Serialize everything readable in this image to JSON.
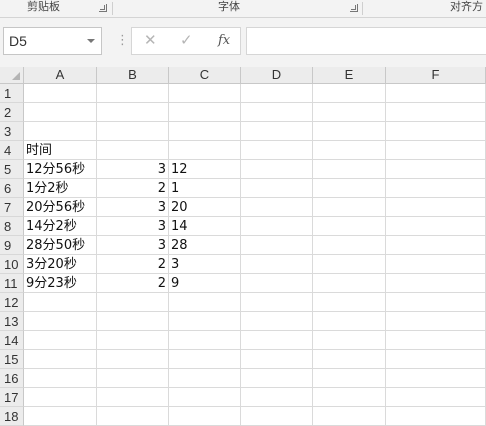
{
  "ribbon": {
    "groups": [
      {
        "label": "剪贴板"
      },
      {
        "label": "字体"
      },
      {
        "label": "对齐方"
      }
    ]
  },
  "formula_bar": {
    "name_box": "D5",
    "cancel_symbol": "✕",
    "enter_symbol": "✓",
    "fx_label": "fx",
    "formula_value": ""
  },
  "sheet": {
    "columns": [
      "A",
      "B",
      "C",
      "D",
      "E",
      "F"
    ],
    "rows": [
      {
        "num": "1",
        "a": "",
        "b": "",
        "c": ""
      },
      {
        "num": "2",
        "a": "",
        "b": "",
        "c": ""
      },
      {
        "num": "3",
        "a": "",
        "b": "",
        "c": ""
      },
      {
        "num": "4",
        "a": "时间",
        "b": "",
        "c": ""
      },
      {
        "num": "5",
        "a": "12分56秒",
        "b": "3",
        "c": "12"
      },
      {
        "num": "6",
        "a": "1分2秒",
        "b": "2",
        "c": "1"
      },
      {
        "num": "7",
        "a": "20分56秒",
        "b": "3",
        "c": "20"
      },
      {
        "num": "8",
        "a": "14分2秒",
        "b": "3",
        "c": "14"
      },
      {
        "num": "9",
        "a": "28分50秒",
        "b": "3",
        "c": "28"
      },
      {
        "num": "10",
        "a": "3分20秒",
        "b": "2",
        "c": "3"
      },
      {
        "num": "11",
        "a": "9分23秒",
        "b": "2",
        "c": "9"
      },
      {
        "num": "12",
        "a": "",
        "b": "",
        "c": ""
      },
      {
        "num": "13",
        "a": "",
        "b": "",
        "c": ""
      },
      {
        "num": "14",
        "a": "",
        "b": "",
        "c": ""
      },
      {
        "num": "15",
        "a": "",
        "b": "",
        "c": ""
      },
      {
        "num": "16",
        "a": "",
        "b": "",
        "c": ""
      },
      {
        "num": "17",
        "a": "",
        "b": "",
        "c": ""
      },
      {
        "num": "18",
        "a": "",
        "b": "",
        "c": ""
      }
    ]
  }
}
